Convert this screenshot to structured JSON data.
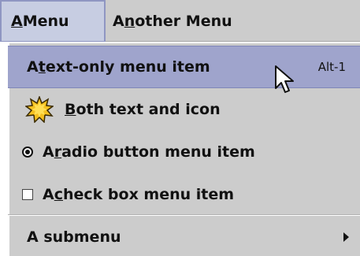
{
  "menubar": {
    "menus": [
      {
        "label_pre": "",
        "mnemonic": "A",
        "label_post": " Menu",
        "active": true
      },
      {
        "label_pre": "A",
        "mnemonic": "n",
        "label_post": "other Menu",
        "active": false
      }
    ]
  },
  "popup": {
    "items": [
      {
        "type": "text",
        "label_pre": "A ",
        "mnemonic": "t",
        "label_post": "ext-only menu item",
        "accelerator": "Alt-1",
        "selected": true
      },
      {
        "type": "icon",
        "icon": "starburst-icon",
        "label_pre": "",
        "mnemonic": "B",
        "label_post": "oth text and icon"
      },
      {
        "type": "radio",
        "checked": true,
        "label_pre": "A ",
        "mnemonic": "r",
        "label_post": "adio button menu item"
      },
      {
        "type": "checkbox",
        "checked": false,
        "label_pre": "A ",
        "mnemonic": "c",
        "label_post": "heck box menu item"
      },
      {
        "type": "submenu",
        "label": "A submenu"
      }
    ]
  },
  "colors": {
    "menubar_bg": "#cccccc",
    "active_menu_bg": "#c7cde2",
    "selected_item_bg": "#9fa4cc",
    "icon_fill": "#f4c020"
  }
}
